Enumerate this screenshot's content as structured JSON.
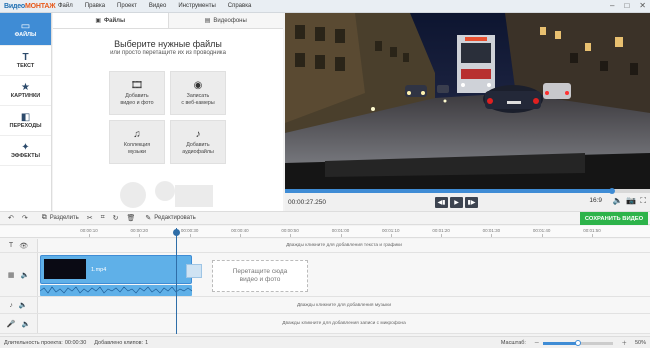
{
  "app": {
    "logo_prefix": "Видео",
    "logo_brand": "МОНТАЖ",
    "menu": [
      "Файл",
      "Правка",
      "Проект",
      "Видео",
      "Инструменты",
      "Справка"
    ]
  },
  "leftnav": [
    {
      "label": "ФАЙЛЫ",
      "icon": "folder-icon",
      "active": true
    },
    {
      "label": "ТЕКСТ",
      "icon": "text-icon",
      "active": false
    },
    {
      "label": "КАРТИНКИ",
      "icon": "star-icon",
      "active": false
    },
    {
      "label": "ПЕРЕХОДЫ",
      "icon": "transitions-icon",
      "active": false
    },
    {
      "label": "ЭФФЕКТЫ",
      "icon": "magic-wand-icon",
      "active": false
    }
  ],
  "panel": {
    "tabs": [
      {
        "label": "Файлы",
        "icon": "files-icon",
        "active": true
      },
      {
        "label": "Видеофоны",
        "icon": "video-backgrounds-icon",
        "active": false
      }
    ],
    "title": "Выберите нужные файлы",
    "subtitle": "или просто перетащите их из проводника",
    "tiles": [
      {
        "line1": "Добавить",
        "line2": "видео и фото",
        "icon": "add-video-icon"
      },
      {
        "line1": "Записать",
        "line2": "с веб-камеры",
        "icon": "webcam-icon"
      },
      {
        "line1": "Коллекция",
        "line2": "музыки",
        "icon": "music-icon"
      },
      {
        "line1": "Добавить",
        "line2": "аудиофайлы",
        "icon": "add-audio-icon"
      }
    ]
  },
  "preview": {
    "timecode": "00:00:27.250",
    "aspect_ratio": "16:9",
    "progress": 0.9,
    "controls": [
      "previous-icon",
      "play-icon",
      "next-icon"
    ]
  },
  "toolbar": {
    "split_label": "Разделить",
    "edit_label": "Редактировать",
    "save_label": "СОХРАНИТЬ ВИДЕО"
  },
  "ruler": {
    "ticks": [
      "00:00:10",
      "00:00:20",
      "00:00:30",
      "00:00:40",
      "00:00:50",
      "00:01:00",
      "00:01:10",
      "00:01:20",
      "00:01:30",
      "00:01:40",
      "00:01:50"
    ]
  },
  "tracks": {
    "text_hint": "Дважды кликните для добавления текста и графики",
    "clip_name": "1.mp4",
    "drop_line1": "Перетащите сюда",
    "drop_line2": "видео и фото",
    "music_hint": "Дважды кликните для добавления музыки",
    "mic_hint": "Дважды кликните для добавления записи с микрофона"
  },
  "status": {
    "duration_label": "Длительность проекта:",
    "duration": "00:00:30",
    "clips_label": "Добавлено клипов:",
    "clips": "1",
    "zoom_label": "Масштаб:",
    "zoom": "50%",
    "zoom_level": 0.5
  },
  "colors": {
    "accent": "#3f8cd5",
    "save_green": "#2db34a"
  }
}
